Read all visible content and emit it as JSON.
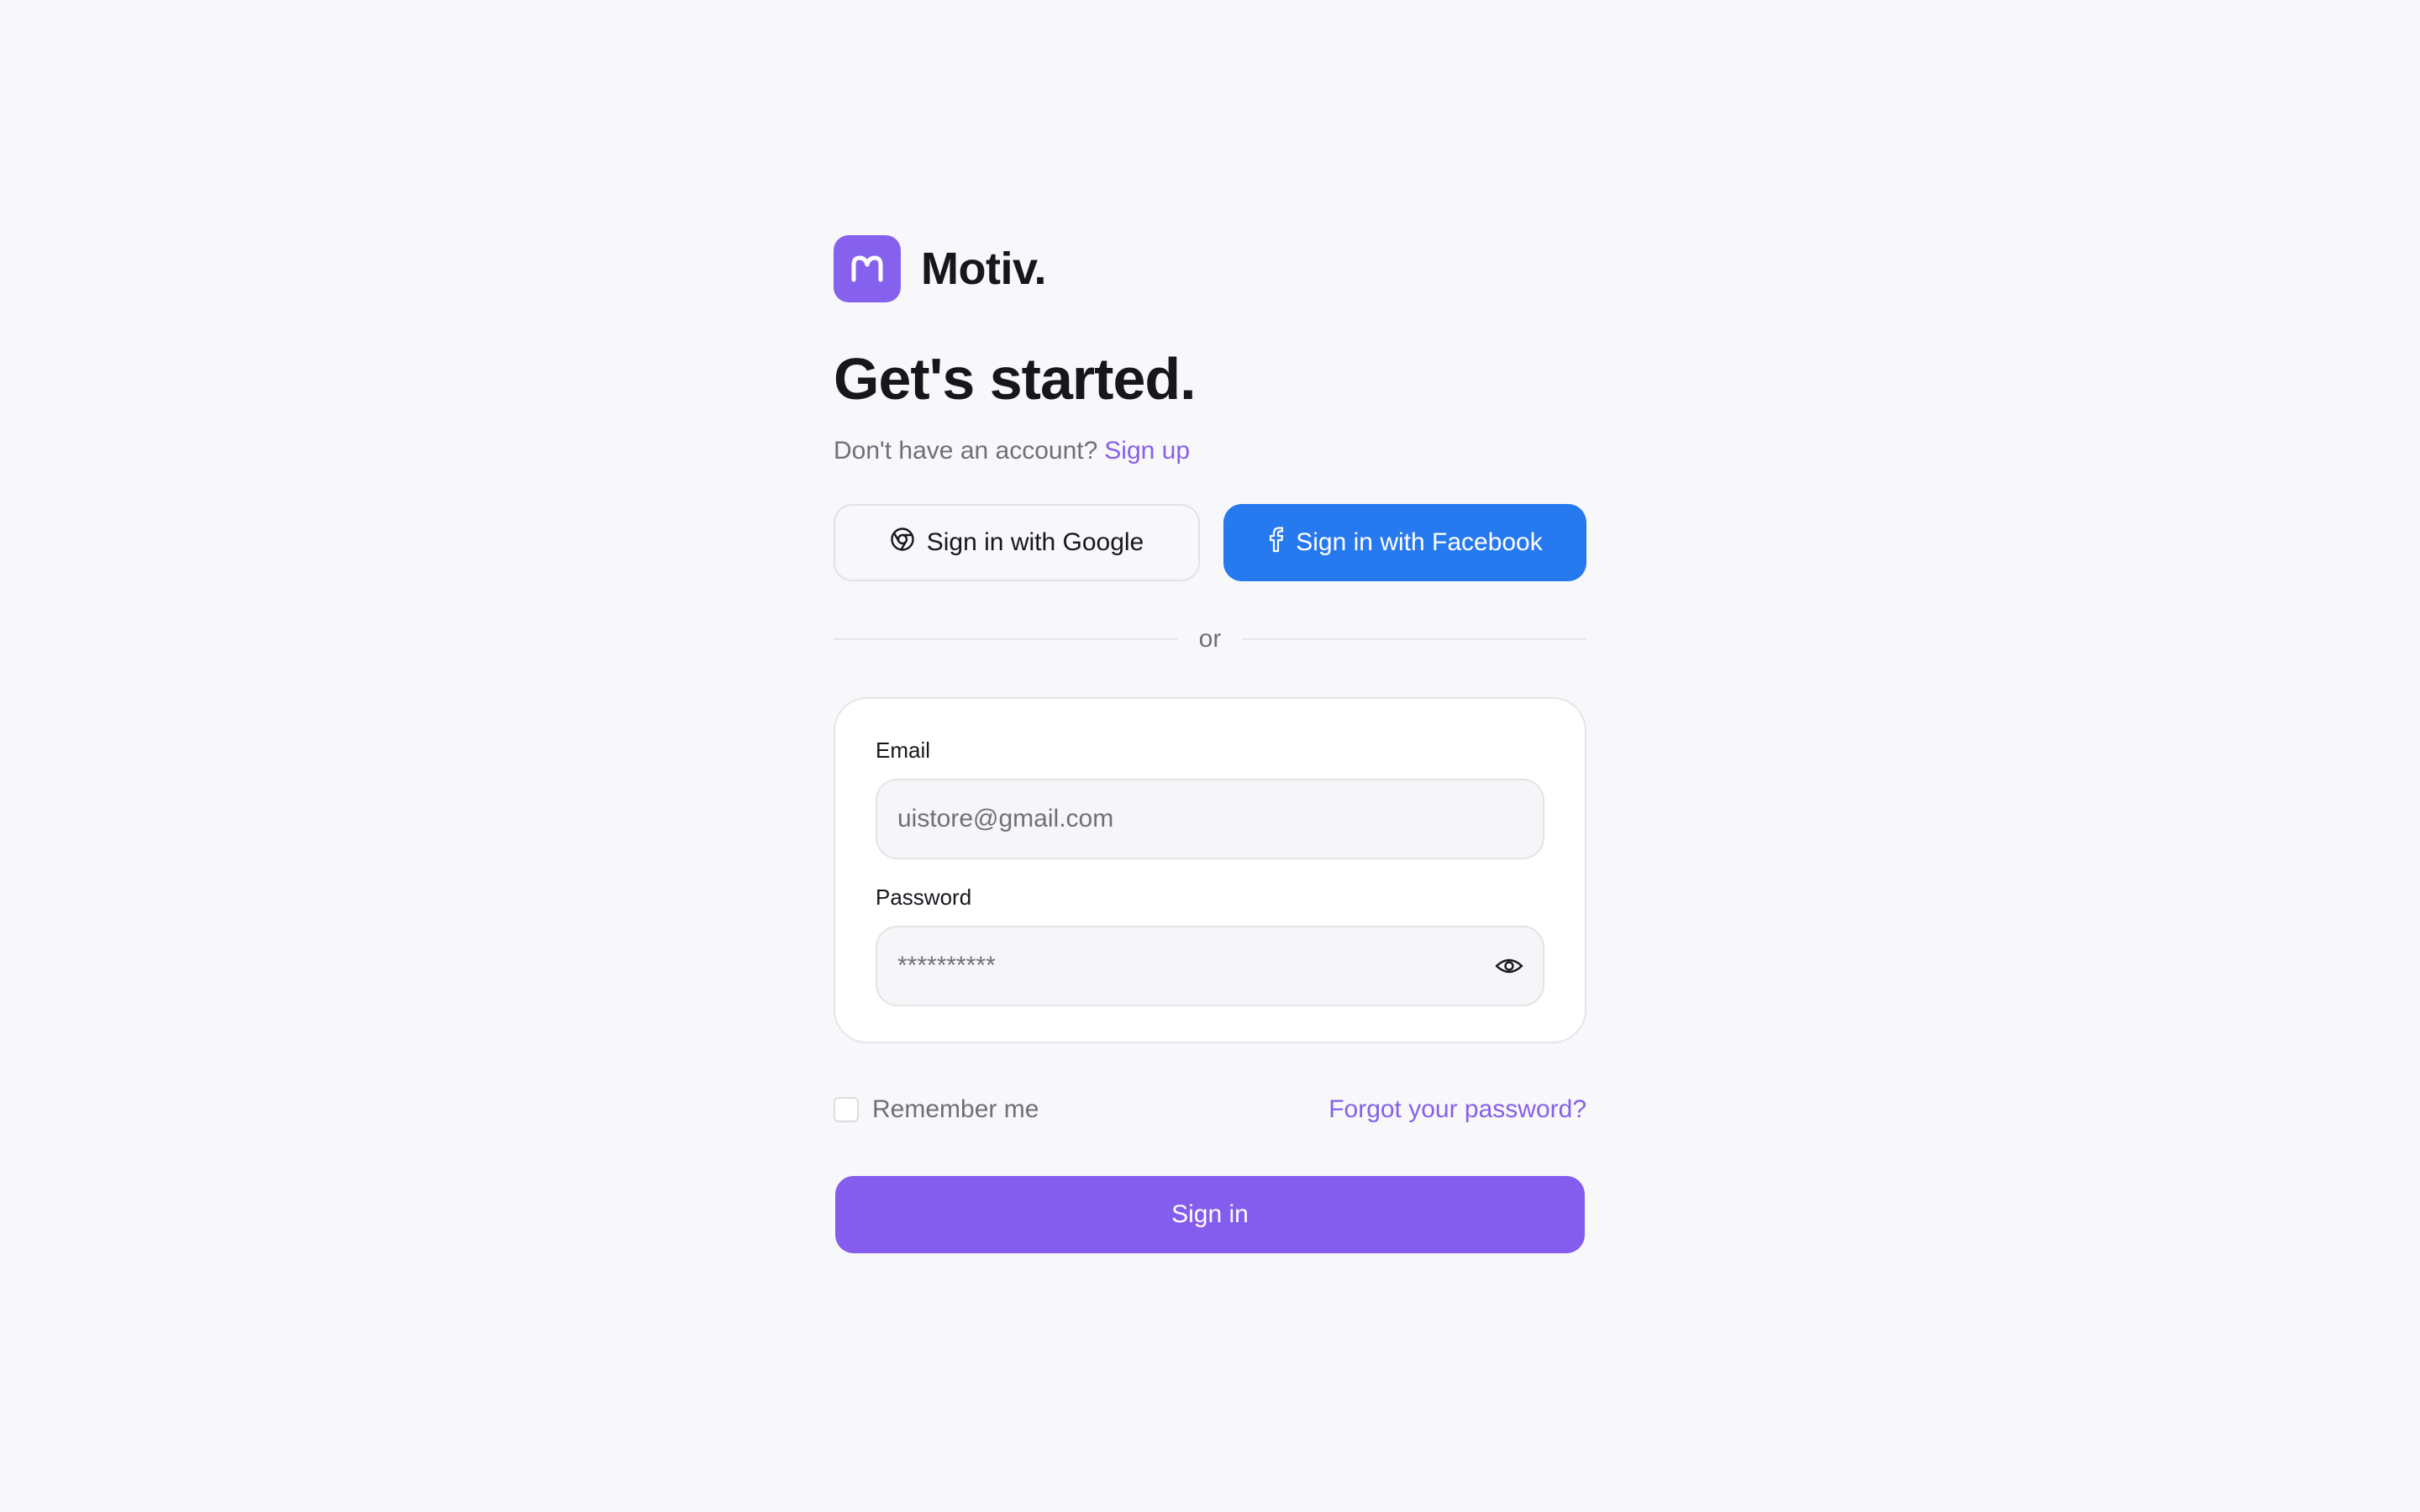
{
  "brand": {
    "name": "Motiv.",
    "logo_icon": "m-letter-icon",
    "color": "#8661ee"
  },
  "headline": "Get's started.",
  "signup_prompt": {
    "text": "Don't have an account?",
    "link": "Sign up"
  },
  "social": {
    "google": {
      "label": "Sign in with Google",
      "icon": "chrome-icon"
    },
    "facebook": {
      "label": "Sign in with Facebook",
      "icon": "facebook-icon",
      "color": "#2779f0"
    }
  },
  "divider_text": "or",
  "form": {
    "email": {
      "label": "Email",
      "value": "uistore@gmail.com"
    },
    "password": {
      "label": "Password",
      "value": "**********",
      "toggle_icon": "eye-icon"
    }
  },
  "remember_me": {
    "label": "Remember me",
    "checked": false
  },
  "forgot_password": "Forgot your password?",
  "submit_label": "Sign in",
  "colors": {
    "accent": "#845cee",
    "link": "#8660ec",
    "background": "#f8f8fa"
  }
}
